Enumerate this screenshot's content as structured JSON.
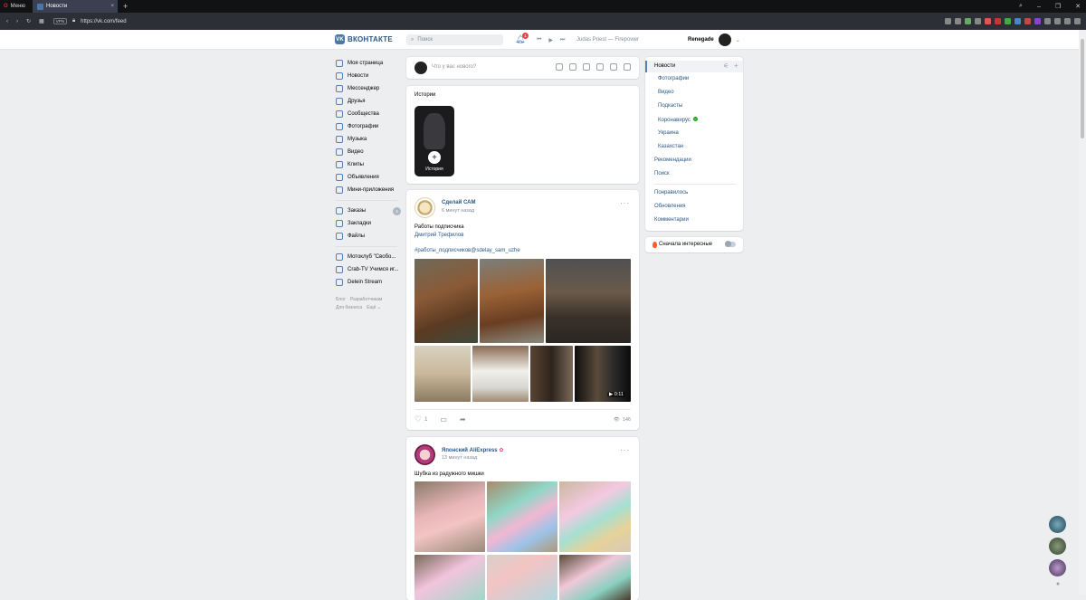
{
  "browser": {
    "menu_label": "Меню",
    "tab_title": "Новости",
    "new_tab": "+",
    "url": "https://vk.com/feed",
    "vpn": "VPN"
  },
  "header": {
    "logo": "ВКОНТАКТЕ",
    "search_placeholder": "Поиск",
    "notifications_count": "1",
    "track": "Judas Priest — Firepower",
    "username": "Renegade"
  },
  "left_nav": {
    "items": [
      {
        "label": "Моя страница"
      },
      {
        "label": "Новости"
      },
      {
        "label": "Мессенджер"
      },
      {
        "label": "Друзья"
      },
      {
        "label": "Сообщества"
      },
      {
        "label": "Фотографии"
      },
      {
        "label": "Музыка"
      },
      {
        "label": "Видео"
      },
      {
        "label": "Клипы"
      },
      {
        "label": "Объявления"
      },
      {
        "label": "Мини-приложения"
      }
    ],
    "items2": [
      {
        "label": "Заказы",
        "count": "4"
      },
      {
        "label": "Закладки"
      },
      {
        "label": "Файлы"
      }
    ],
    "items3": [
      {
        "label": "Мотоклуб \"Свобо..."
      },
      {
        "label": "Crab-TV Учимся иг..."
      },
      {
        "label": "Delein Stream"
      }
    ],
    "footer": {
      "blog": "Блог",
      "devs": "Разработчикам",
      "business": "Для бизнеса",
      "more": "Ещё ⌄"
    }
  },
  "composer": {
    "placeholder": "Что у вас нового?"
  },
  "stories": {
    "title": "Истории",
    "tile_label": "История"
  },
  "post1": {
    "author": "Сделай САМ",
    "time": "6 минут назад",
    "text1": "Работы подписчика",
    "text2": "Дмитрий Трефилов",
    "hashtag": "#работы_подписчиков@sdelay_sam_uzhe",
    "video_duration": "▶ 0:11",
    "likes": "1",
    "views": "146"
  },
  "post2": {
    "author": "Японский AliExpress",
    "time": "13 минут назад",
    "text": "Шубка из радужного мишки"
  },
  "right_menu": {
    "active": "Новости",
    "sub": [
      "Фотографии",
      "Видео",
      "Подкасты",
      "Коронавирус",
      "Украина",
      "Казахстан"
    ],
    "main": [
      "Рекомендации",
      "Поиск"
    ],
    "bottom": [
      "Понравилось",
      "Обновления",
      "Комментарии"
    ]
  },
  "interesting": {
    "label": "Сначала интересные"
  }
}
